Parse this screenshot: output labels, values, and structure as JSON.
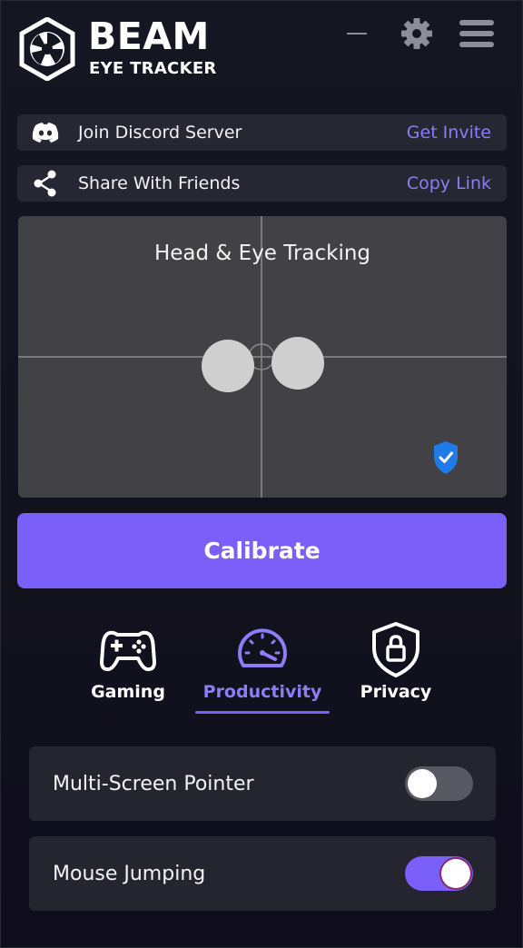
{
  "header": {
    "title": "BEAM",
    "subtitle": "EYE TRACKER",
    "icons": [
      "beam-logo",
      "minimize-icon",
      "gear-icon",
      "hamburger-menu-icon"
    ]
  },
  "discord": {
    "label": "Join Discord Server",
    "link": "Get Invite",
    "icon": "discord-icon"
  },
  "share": {
    "label": "Share With Friends",
    "link": "Copy Link",
    "icon": "share-icon"
  },
  "tracking": {
    "title": "Head & Eye Tracking",
    "status_icon": "shield-check-icon"
  },
  "calibrate": {
    "label": "Calibrate"
  },
  "modes": {
    "selected": "Productivity",
    "tabs": [
      {
        "label": "Gaming",
        "icon": "gamepad-icon"
      },
      {
        "label": "Productivity",
        "icon": "speedometer-icon"
      },
      {
        "label": "Privacy",
        "icon": "shield-lock-icon"
      }
    ]
  },
  "settings": [
    {
      "label": "Multi-Screen Pointer",
      "enabled": false
    },
    {
      "label": "Mouse Jumping",
      "enabled": true
    }
  ],
  "colors": {
    "accent": "#7a5ff8",
    "link": "#8e7cf6",
    "background": "#12121d",
    "panel": "#262733",
    "tracker_bg": "#424246",
    "shield": "#1f7be8"
  }
}
